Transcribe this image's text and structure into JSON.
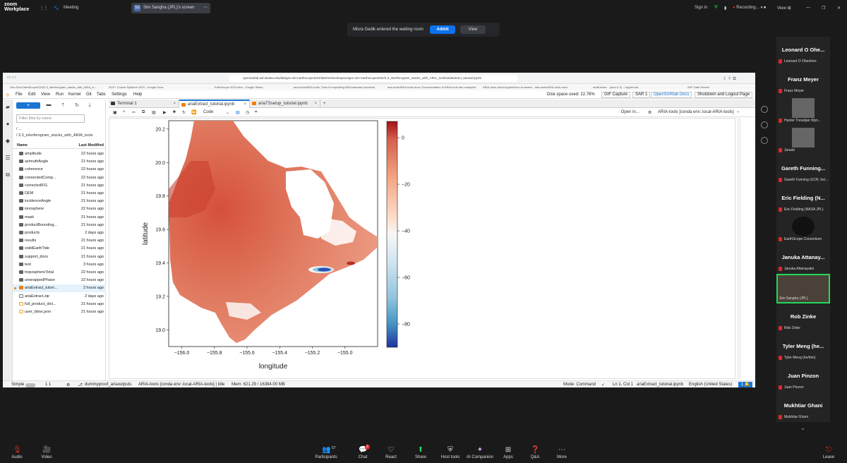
{
  "zoom": {
    "app_name": "Workplace",
    "brand": "zoom",
    "meeting_label": "Meeting",
    "share_badge": "SS",
    "share_label": "Sim Sangha (JPL)'s screen",
    "sign_in": "Sign in",
    "recording": "Recording...",
    "view": "View",
    "waiting_message": "Misra Gedik entered the waiting room",
    "admit": "Admit",
    "waiting_view": "View"
  },
  "browser": {
    "url": "opensarlab.asf.alaska.edu/lab/geo-sbi-earthscope2024/lab/tree/workspace/geo-sim-earthscope2024/3.3_interferogram_stacks_with_ARIA_tools/ariaExtract_tutorial.ipynb",
    "bookmarks": [
      "Geo-Sim-EarthScope2024/3.3_interferogram_stacks_with_ARIA_to...",
      "SCE+ Course Syllabus 2024 - Google Docs",
      "EarthScope 2024 Intro - Google Slides",
      "aria-tools/ARIA-tools: Tools for exploiting ARIA standard products",
      "aria-tools/ARIA-tools-docs: Documentation of ARIA tools and examples",
      "ARIA-tools-docs/JupyterDocs at master - aria-tools/ARIA-tools-docs",
      "ariaExtract... (auto-4-3) - JupyterLab",
      "ASF Data Search"
    ]
  },
  "jupyter": {
    "menu": [
      "File",
      "Edit",
      "View",
      "Run",
      "Kernel",
      "Git",
      "Tabs",
      "Settings",
      "Help"
    ],
    "disk_space": "Disk space used: 22.76%",
    "gif_capture": "GIF Capture",
    "sar": "SAR 1",
    "opensarlab_docs": "OpenSARlab Docs",
    "shutdown": "Shutdown and Logout Page",
    "filter_placeholder": "Filter files by name",
    "crumb1": "/ ...",
    "crumb2": "/ 3.3_interferogram_stacks_with_ARIA_tools",
    "col_name": "Name",
    "col_modified": "Last Modified",
    "files": [
      {
        "name": "amplitude",
        "modified": "22 hours ago",
        "type": "folder"
      },
      {
        "name": "azimuthAngle",
        "modified": "21 hours ago",
        "type": "folder"
      },
      {
        "name": "coherence",
        "modified": "22 hours ago",
        "type": "folder"
      },
      {
        "name": "connectedComp...",
        "modified": "22 hours ago",
        "type": "folder"
      },
      {
        "name": "correctedIFG",
        "modified": "21 hours ago",
        "type": "folder"
      },
      {
        "name": "DEM",
        "modified": "21 hours ago",
        "type": "folder"
      },
      {
        "name": "incidenceAngle",
        "modified": "21 hours ago",
        "type": "folder"
      },
      {
        "name": "ionosphere",
        "modified": "22 hours ago",
        "type": "folder"
      },
      {
        "name": "mask",
        "modified": "21 hours ago",
        "type": "folder"
      },
      {
        "name": "productBounding...",
        "modified": "21 hours ago",
        "type": "folder"
      },
      {
        "name": "products",
        "modified": "2 days ago",
        "type": "folder"
      },
      {
        "name": "results",
        "modified": "21 hours ago",
        "type": "folder"
      },
      {
        "name": "solidEarthTide",
        "modified": "21 hours ago",
        "type": "folder"
      },
      {
        "name": "support_docs",
        "modified": "21 hours ago",
        "type": "folder"
      },
      {
        "name": "test",
        "modified": "3 hours ago",
        "type": "folder"
      },
      {
        "name": "troposphereTotal",
        "modified": "22 hours ago",
        "type": "folder"
      },
      {
        "name": "unwrappedPhase",
        "modified": "22 hours ago",
        "type": "folder"
      },
      {
        "name": "ariaExtract_tutori...",
        "modified": "2 hours ago",
        "type": "nb"
      },
      {
        "name": "ariaExtract.zip",
        "modified": "2 days ago",
        "type": "zip"
      },
      {
        "name": "full_product_dict...",
        "modified": "21 hours ago",
        "type": "json"
      },
      {
        "name": "user_bbox.json",
        "modified": "21 hours ago",
        "type": "json"
      }
    ],
    "tabs": [
      {
        "label": "Terminal 1"
      },
      {
        "label": "ariaExtract_tutorial.ipynb"
      },
      {
        "label": "ariaTSsetup_tutorial.ipynb"
      }
    ],
    "cell_type": "Code",
    "open_in": "Open in...",
    "kernel": "ARIA-tools [conda env:.local-ARIA-tools]",
    "status": {
      "simple": "Simple",
      "counts": "1  1",
      "dummy": "dummyproof_ariaoutputs",
      "kernel_state": "ARIA-tools [conda env:.local-ARIA-tools] | Idle",
      "mem": "Mem: 621.29 / 16384.00 MB",
      "mode": "Mode: Command",
      "lncol": "Ln 1, Col 1",
      "file": "ariaExtract_tutorial.ipynb",
      "lang": "English (United States)",
      "notif": "1"
    }
  },
  "chart_data": {
    "type": "heatmap",
    "xlabel": "longitude",
    "ylabel": "latitude",
    "xlim": [
      -156.08,
      -154.8
    ],
    "ylim": [
      18.9,
      20.25
    ],
    "xticks": [
      "−156.0",
      "−155.8",
      "−155.6",
      "−155.4",
      "−155.2",
      "−155.0"
    ],
    "xtick_values": [
      -156.0,
      -155.8,
      -155.6,
      -155.4,
      -155.2,
      -155.0
    ],
    "yticks": [
      "19.0",
      "19.2",
      "19.4",
      "19.6",
      "19.8",
      "20.0",
      "20.2"
    ],
    "ytick_values": [
      19.0,
      19.2,
      19.4,
      19.6,
      19.8,
      20.0,
      20.2
    ],
    "colorbar": {
      "min": -90,
      "max": 7,
      "ticks": [
        "0",
        "−20",
        "−40",
        "−60",
        "−80"
      ],
      "tick_values": [
        0,
        -20,
        -40,
        -60,
        -80
      ],
      "cmap": "RdBu"
    },
    "colors": {
      "red": "#d6604d",
      "white": "#f7f7f7",
      "blue": "#2166ac"
    }
  },
  "gallery": [
    {
      "big": "Leonard O Ohe...",
      "small": "Leonard O Ohenhen",
      "kind": "name"
    },
    {
      "big": "Franz Meyer",
      "small": "Franz Meyer",
      "kind": "name"
    },
    {
      "big": "",
      "small": "Hunter Treveljan Wyn...",
      "kind": "photo"
    },
    {
      "big": "",
      "small": "Junaid",
      "kind": "photo"
    },
    {
      "big": "Gareth Funning...",
      "small": "Gareth Funning (UCR, he/...",
      "kind": "name"
    },
    {
      "big": "Eric Fielding (N...",
      "small": "Eric Fielding (NASA JPL)",
      "kind": "name"
    },
    {
      "big": "",
      "small": "EarthScope Consortium",
      "kind": "logo"
    },
    {
      "big": "Januka Attanay...",
      "small": "Januka Attanayake",
      "kind": "name"
    },
    {
      "big": "",
      "small": "Sim Sangha (JPL)",
      "kind": "video"
    },
    {
      "big": "Rob Zinke",
      "small": "Rob Zinke",
      "kind": "name"
    },
    {
      "big": "Tyler Meng (he...",
      "small": "Tyler Meng (he/him)",
      "kind": "name"
    },
    {
      "big": "Juan Pinzon",
      "small": "Juan Pinzon",
      "kind": "name"
    },
    {
      "big": "Mukhtiar Ghani",
      "small": "Mukhtiar Ghani",
      "kind": "name"
    }
  ],
  "bottom": {
    "audio": "Audio",
    "video": "Video",
    "participants": "Participants",
    "participant_count": "57",
    "chat": "Chat",
    "chat_badge": "2",
    "react": "React",
    "share": "Share",
    "host_tools": "Host tools",
    "ai_companion": "AI Companion",
    "apps": "Apps",
    "qa": "Q&A",
    "more": "More",
    "leave": "Leave"
  }
}
